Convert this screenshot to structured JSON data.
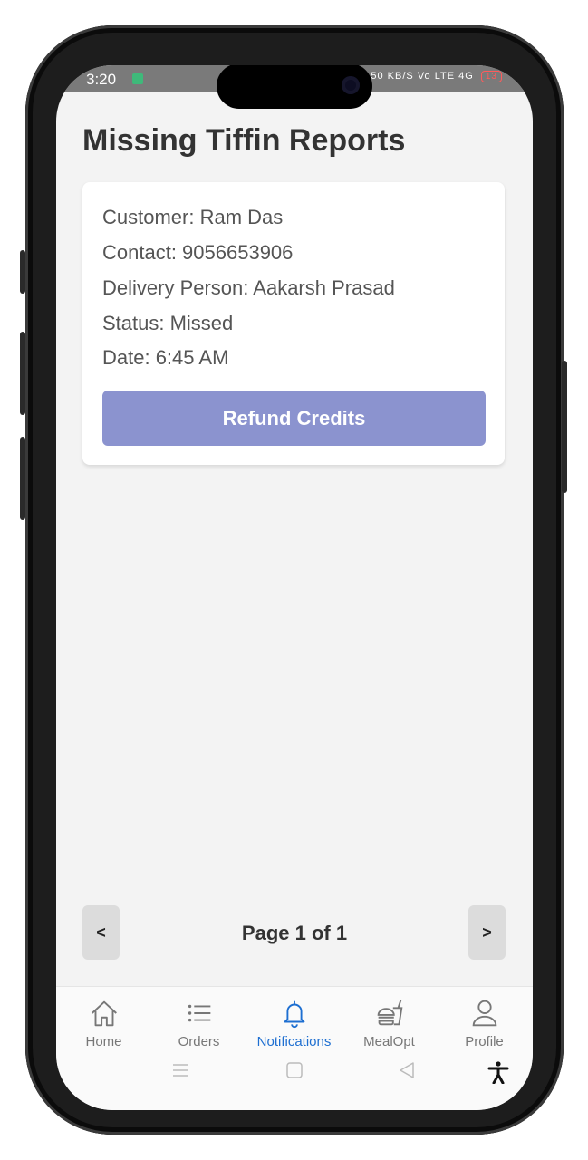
{
  "status_bar": {
    "time": "3:20",
    "net_speed": "0.50 KB/S",
    "signal_text": "Vo LTE 4G",
    "battery": "13"
  },
  "page": {
    "title": "Missing Tiffin Reports"
  },
  "report": {
    "customer": "Customer: Ram Das",
    "contact": "Contact: 9056653906",
    "delivery_person": "Delivery Person: Aakarsh Prasad",
    "status": "Status: Missed",
    "date": "Date: 6:45 AM",
    "action_label": "Refund Credits"
  },
  "pagination": {
    "prev_label": "<",
    "next_label": ">",
    "page_text": "Page 1 of 1"
  },
  "tabs": [
    {
      "label": "Home",
      "icon": "home-icon"
    },
    {
      "label": "Orders",
      "icon": "list-icon"
    },
    {
      "label": "Notifications",
      "icon": "bell-icon",
      "active": true
    },
    {
      "label": "MealOpt",
      "icon": "meal-icon"
    },
    {
      "label": "Profile",
      "icon": "person-icon"
    }
  ],
  "colors": {
    "accent": "#1e6fd1",
    "button": "#8b93cf",
    "background": "#f3f3f3"
  }
}
